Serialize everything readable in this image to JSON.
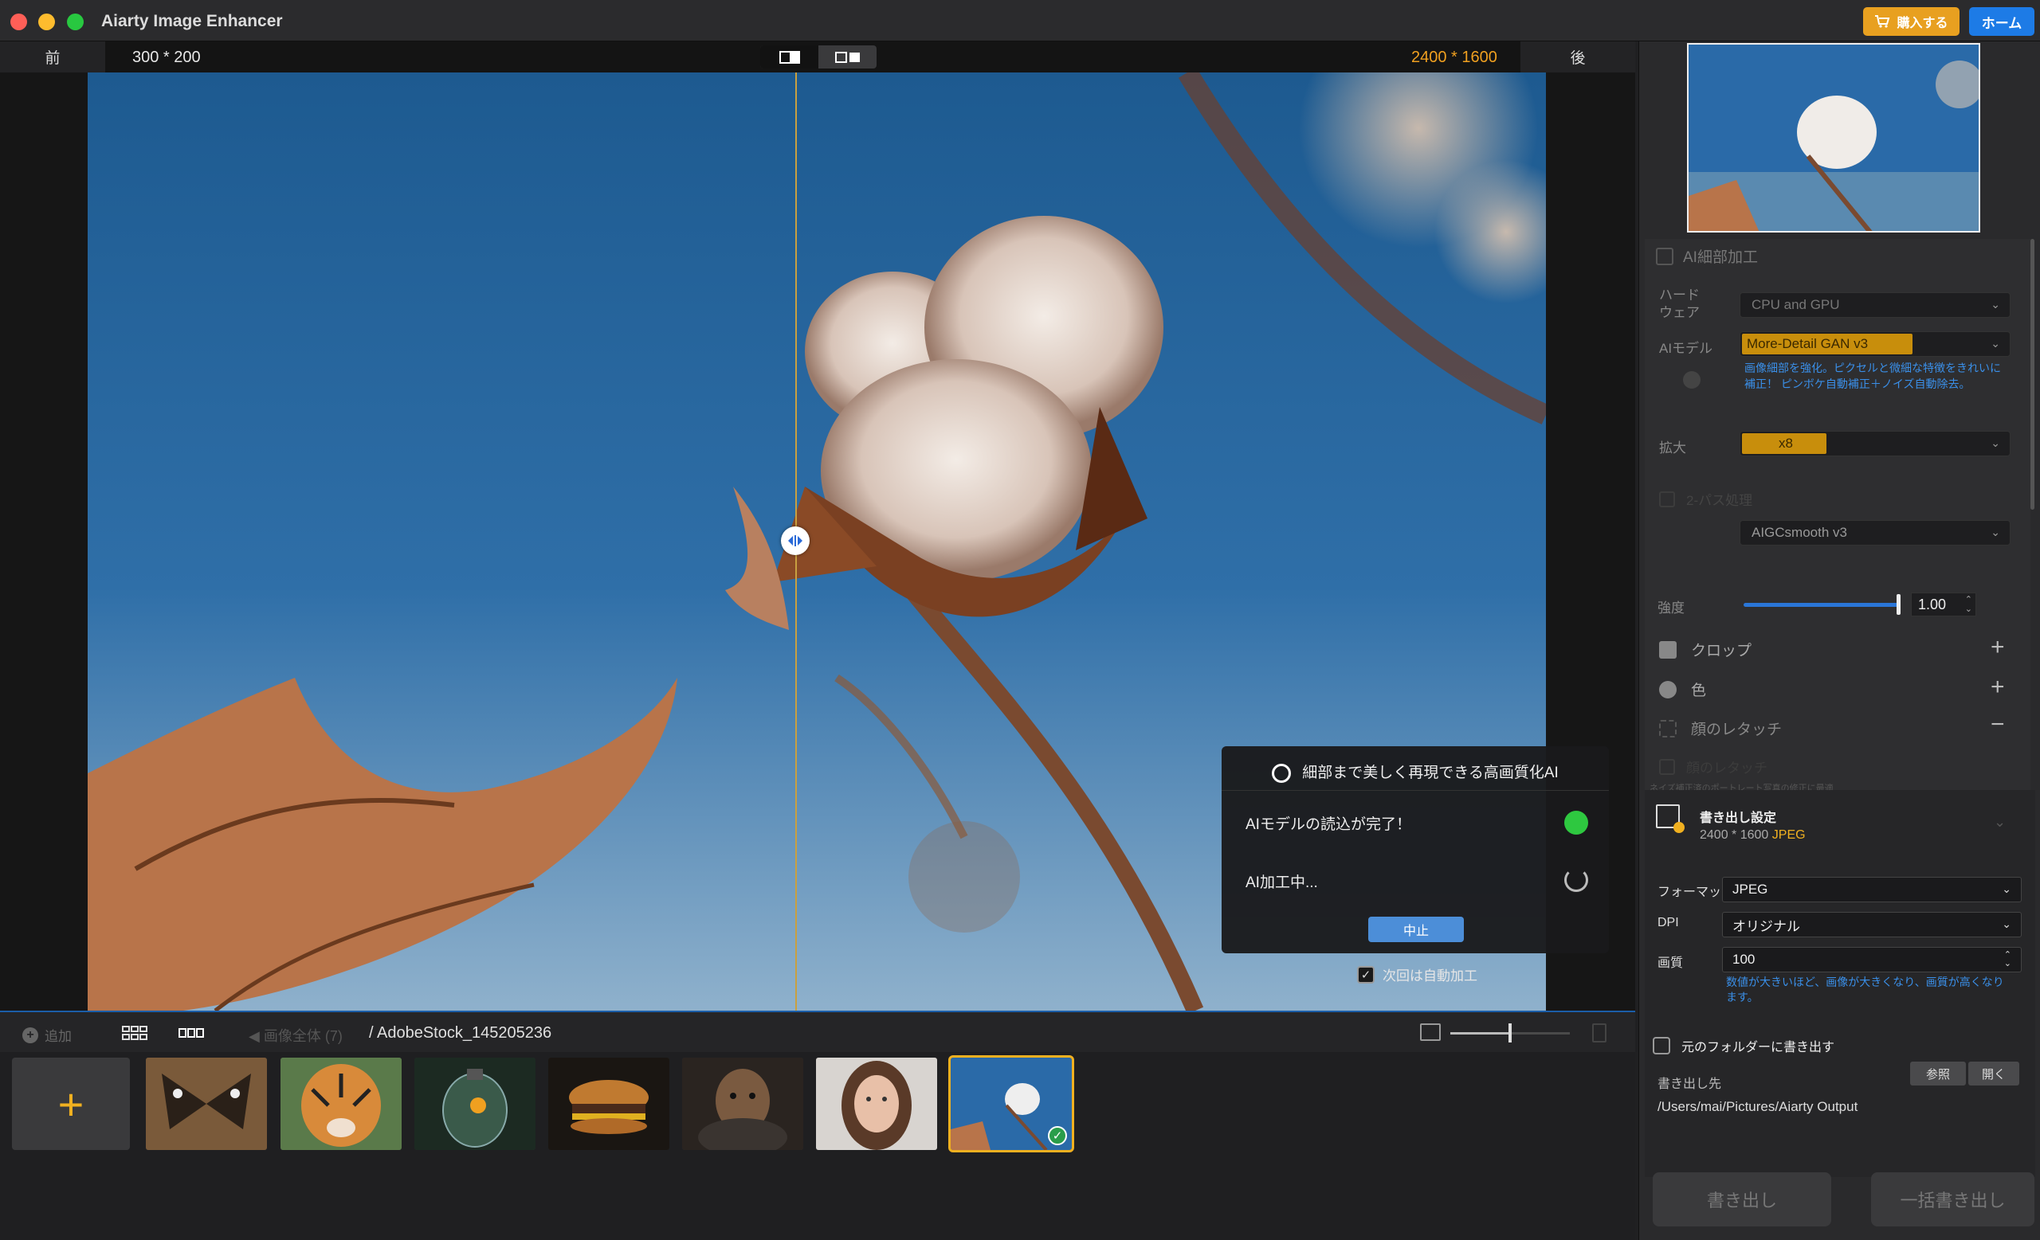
{
  "window": {
    "title": "Aiarty Image Enhancer",
    "buy_label": "購入する",
    "home_label": "ホーム"
  },
  "compare": {
    "before_label": "前",
    "before_size": "300 * 200",
    "after_size": "2400 * 1600",
    "after_label": "後"
  },
  "processing": {
    "title": "細部まで美しく再現できる高画質化AI",
    "model_loaded": "AIモデルの読込が完了！",
    "processing_text": "AI加工中...",
    "stop_label": "中止",
    "auto_process_label": "次回は自動加工",
    "auto_process_checked": true
  },
  "filmstrip": {
    "add_label": "追加",
    "back_label": "画像全体 (7)",
    "path": "/ AdobeStock_145205236",
    "zoom_level": 0.5,
    "thumbnails": [
      {
        "name": "butterfly",
        "selected": false
      },
      {
        "name": "tiger",
        "selected": false
      },
      {
        "name": "terrarium",
        "selected": false
      },
      {
        "name": "burger",
        "selected": false
      },
      {
        "name": "dog-portrait",
        "selected": false
      },
      {
        "name": "woman-portrait",
        "selected": false
      },
      {
        "name": "cotton",
        "selected": true
      }
    ]
  },
  "panel": {
    "ai_detail_label": "AI細部加工",
    "hardware_label": "ハードウェア",
    "hardware_value": "CPU and GPU",
    "model_label": "AIモデル",
    "model_value": "More-Detail GAN  v3",
    "model_desc": "画像細部を強化。ピクセルと微細な特徴をきれいに補正！ ピンボケ自動補正＋ノイズ自動除去。",
    "scale_label": "拡大",
    "scale_value": "x8",
    "twopass_label": "2-パス処理",
    "second_model_value": "AIGCsmooth  v3",
    "strength_label": "強度",
    "strength_value": "1.00",
    "crop_label": "クロップ",
    "color_label": "色",
    "face_label": "顔のレタッチ",
    "face_sub_label": "顔のレタッチ",
    "face_note": "ネイズ補正済のポートレート写真の修正に最適"
  },
  "export": {
    "title": "書き出し設定",
    "size": "2400 * 1600",
    "format_tag": "JPEG",
    "format_label": "フォーマット",
    "format_value": "JPEG",
    "dpi_label": "DPI",
    "dpi_value": "オリジナル",
    "quality_label": "画質",
    "quality_value": "100",
    "quality_note": "数値が大きいほど、画像が大きくなり、画質が高くなります。",
    "orig_folder_label": "元のフォルダーに書き出す",
    "dest_label": "書き出し先",
    "browse_label": "参照",
    "open_label": "開く",
    "dest_path": "/Users/mai/Pictures/Aiarty Output",
    "export_label": "書き出し",
    "batch_label": "一括書き出し"
  },
  "colors": {
    "accent": "#f0b020",
    "blue": "#1d7be6",
    "link_text": "#3a8fe8",
    "ok": "#2ec840"
  }
}
